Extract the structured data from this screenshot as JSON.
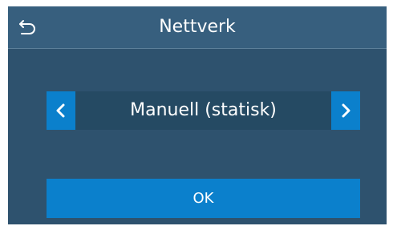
{
  "header": {
    "title": "Nettverk",
    "back_icon": "back-arrow-icon"
  },
  "selector": {
    "value": "Manuell (statisk)",
    "prev_icon": "chevron-left-icon",
    "next_icon": "chevron-right-icon"
  },
  "actions": {
    "ok_label": "OK"
  },
  "colors": {
    "background": "#2e526e",
    "header": "#375f7e",
    "selector_field": "#254a63",
    "accent": "#0b80cc",
    "text": "#ffffff"
  }
}
